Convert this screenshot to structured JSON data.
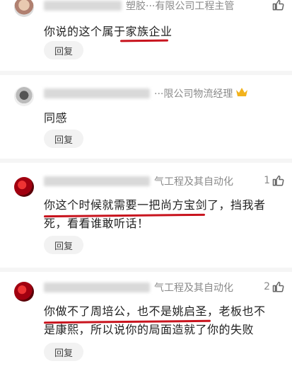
{
  "comments": [
    {
      "name_tail": "塑胶···有限公司工程主管",
      "like_count": "",
      "text_lines": [
        "你说的这个属于家族企业"
      ],
      "reply_label": "回复",
      "crown": false
    },
    {
      "name_tail": "···限公司物流经理",
      "like_count": "",
      "text_lines": [
        "同感"
      ],
      "reply_label": "回复",
      "crown": true
    },
    {
      "name_tail": "气工程及其自动化",
      "like_count": "1",
      "text_lines": [
        "你这个时候就需要一把尚方宝剑了，挡我者",
        "死，看看谁敢听话！"
      ],
      "reply_label": "回复",
      "crown": false
    },
    {
      "name_tail": "气工程及其自动化",
      "like_count": "2",
      "text_lines": [
        "你做不了周培公，也不是姚启圣，老板也不",
        "是康熙，所以说你的局面造就了你的失败"
      ],
      "reply_label": "回复",
      "crown": false
    }
  ],
  "colors": {
    "annotation_red": "#c8141e",
    "meta_gray": "#8a8a8a",
    "reply_bg": "#f2f2f2"
  }
}
